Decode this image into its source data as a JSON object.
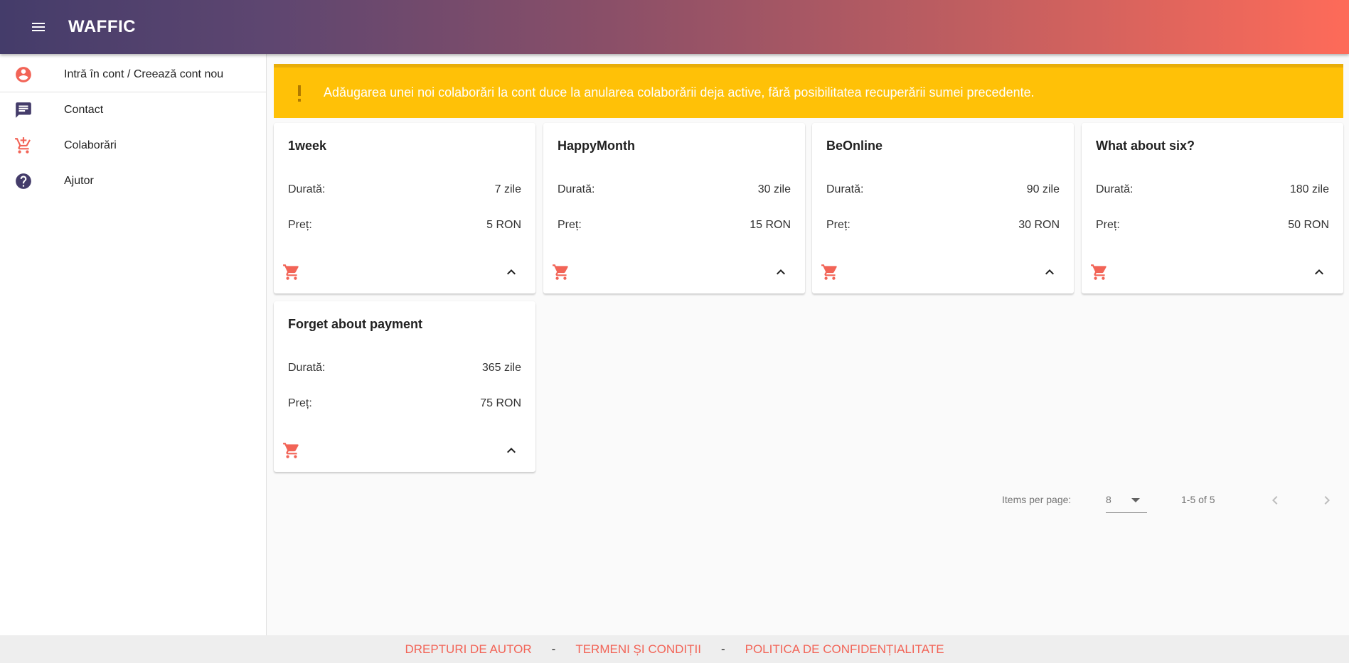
{
  "app": {
    "title": "WAFFIC"
  },
  "colors": {
    "accent": "#f26457",
    "nav_dark": "#443c6a",
    "warning_bg": "#ffc107"
  },
  "sidebar": {
    "items": [
      {
        "label": "Intră în cont / Creează cont nou",
        "icon": "account-circle-icon"
      },
      {
        "label": "Contact",
        "icon": "chat-icon"
      },
      {
        "label": "Colaborări",
        "icon": "add-shopping-cart-icon"
      },
      {
        "label": "Ajutor",
        "icon": "help-icon"
      }
    ]
  },
  "warning": {
    "icon": "exclamation-icon",
    "text": "Adăugarea unei noi colaborări la cont duce la anularea colaborării deja active, fără posibilitatea recuperării sumei precedente."
  },
  "cards": [
    {
      "title": "1week",
      "duration_label": "Durată:",
      "duration": "7 zile",
      "price_label": "Preț:",
      "price": "5 RON"
    },
    {
      "title": "HappyMonth",
      "duration_label": "Durată:",
      "duration": "30 zile",
      "price_label": "Preț:",
      "price": "15 RON"
    },
    {
      "title": "BeOnline",
      "duration_label": "Durată:",
      "duration": "90 zile",
      "price_label": "Preț:",
      "price": "30 RON"
    },
    {
      "title": "What about six?",
      "duration_label": "Durată:",
      "duration": "180 zile",
      "price_label": "Preț:",
      "price": "50 RON"
    },
    {
      "title": "Forget about payment",
      "duration_label": "Durată:",
      "duration": "365 zile",
      "price_label": "Preț:",
      "price": "75 RON"
    }
  ],
  "paginator": {
    "items_per_page_label": "Items per page:",
    "items_per_page": "8",
    "range": "1-5 of 5"
  },
  "footer": {
    "links": [
      "DREPTURI DE AUTOR",
      "TERMENI ȘI CONDIȚII",
      "POLITICA DE CONFIDENȚIALITATE"
    ],
    "separator": "-"
  }
}
